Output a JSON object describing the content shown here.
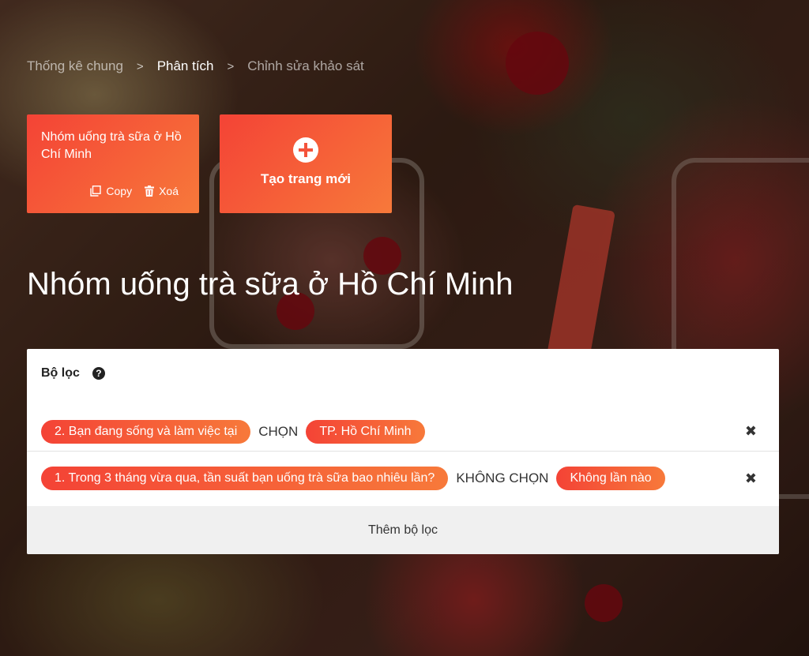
{
  "breadcrumb": {
    "items": [
      "Thống kê chung",
      "Phân tích",
      "Chỉnh sửa khảo sát"
    ],
    "active_index": 1,
    "separator": ">"
  },
  "pages": [
    {
      "title": "Nhóm uống trà sữa ở Hồ Chí Minh",
      "copy_label": "Copy",
      "delete_label": "Xoá"
    }
  ],
  "new_page": {
    "label": "Tạo trang mới"
  },
  "page_title": "Nhóm uống trà sữa ở Hồ Chí Minh",
  "filter_panel": {
    "title": "Bộ lọc",
    "help_icon": "?",
    "filters": [
      {
        "question": "2. Bạn đang sống và làm việc tại",
        "operator": "CHỌN",
        "answer": "TP. Hồ Chí Minh"
      },
      {
        "question": "1. Trong 3 tháng vừa qua, tần suất bạn uống trà sữa bao nhiêu lần?",
        "operator": "KHÔNG CHỌN",
        "answer": "Không lần nào"
      }
    ],
    "remove_icon": "✖",
    "add_label": "Thêm bộ lọc"
  },
  "colors": {
    "accent_start": "#f44336",
    "accent_end": "#f7793a"
  }
}
